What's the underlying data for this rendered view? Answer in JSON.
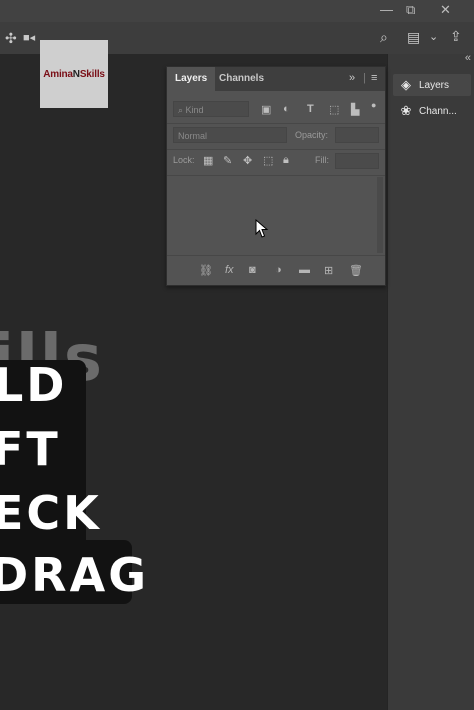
{
  "window_controls": {
    "minimize": "—",
    "restore": "⧉",
    "close": "✕"
  },
  "options_bar": {
    "left_icons": [
      "move-tool-icon",
      "video-icon"
    ],
    "right_icons": [
      "search-icon",
      "workspace-icon",
      "chevron-down-icon",
      "share-icon"
    ]
  },
  "canvas": {
    "logo": {
      "part1": "Amina",
      "part2": "N",
      "part3": "Skills"
    },
    "ghost_text": "ills",
    "lines": [
      "LD",
      "FT",
      "ECK",
      "DRAG"
    ]
  },
  "layers_panel": {
    "tabs": [
      "Layers",
      "Channels"
    ],
    "filter": {
      "placeholder": "Kind",
      "icons": [
        "image-filter-icon",
        "adjustment-filter-icon",
        "type-filter-icon",
        "shape-filter-icon",
        "smart-object-filter-icon",
        "filter-toggle-icon"
      ]
    },
    "blend_mode": "Normal",
    "opacity_label": "Opacity:",
    "lock_label": "Lock:",
    "fill_label": "Fill:",
    "lock_icons": [
      "lock-transparent-icon",
      "lock-brush-icon",
      "lock-position-icon",
      "lock-artboard-icon",
      "lock-all-icon"
    ],
    "bottom_icons": [
      "link-layers-icon",
      "fx-icon",
      "add-mask-icon",
      "adjustment-layer-icon",
      "new-group-icon",
      "new-layer-icon",
      "delete-layer-icon"
    ]
  },
  "dock": {
    "collapse": "«",
    "items": [
      {
        "label": "Layers",
        "icon": "layers-icon"
      },
      {
        "label": "Chann...",
        "icon": "channels-icon"
      }
    ]
  }
}
